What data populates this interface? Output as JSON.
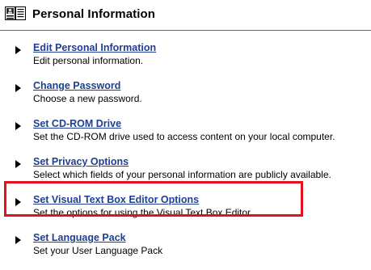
{
  "header": {
    "title": "Personal Information",
    "icon": "personal-info-icon"
  },
  "items": [
    {
      "link": "Edit Personal Information",
      "description": "Edit personal information."
    },
    {
      "link": "Change Password",
      "description": "Choose a new password."
    },
    {
      "link": "Set CD-ROM Drive",
      "description": "Set the CD-ROM drive used to access content on your local computer."
    },
    {
      "link": "Set Privacy Options",
      "description": "Select which fields of your personal information are publicly available."
    },
    {
      "link": "Set Visual Text Box Editor Options",
      "description": "Set the options for using the Visual Text Box Editor.",
      "highlighted": true
    },
    {
      "link": "Set Language Pack",
      "description": "Set your User Language Pack"
    }
  ],
  "colors": {
    "link": "#1f3f93",
    "highlight_border": "#e4101e",
    "rule": "#6a6a6a"
  }
}
